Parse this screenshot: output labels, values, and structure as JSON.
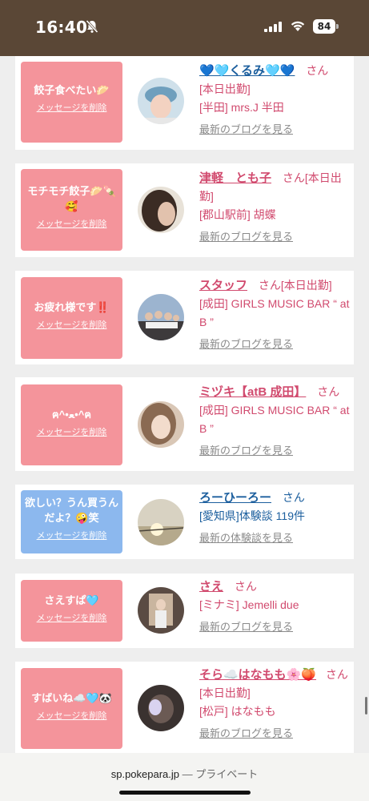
{
  "status_bar": {
    "time": "16:40",
    "battery": "84",
    "icons": [
      "bell-slash-icon",
      "signal-icon",
      "wifi-icon",
      "battery-icon"
    ]
  },
  "messages": [
    {
      "message": "餃子食べたい🥟",
      "delete_label": "メッセージを削除",
      "name": "💙🩵くるみ🩵💙",
      "honorific": "さん",
      "details": [
        "[本日出勤]",
        "[半田] mrs.J 半田"
      ],
      "link": "最新のブログを見る",
      "style": "pink"
    },
    {
      "message": "モチモチ餃子🥟🍡🥰",
      "delete_label": "メッセージを削除",
      "name": "津軽　とも子",
      "honorific": "さん[本日出勤]",
      "details": [
        "[郡山駅前] 胡蝶"
      ],
      "link": "最新のブログを見る",
      "style": "pink"
    },
    {
      "message": "お疲れ様です‼️",
      "delete_label": "メッセージを削除",
      "name": "スタッフ",
      "honorific": "さん[本日出勤]",
      "details": [
        "[成田] GIRLS MUSIC BAR “ at B ”"
      ],
      "link": "最新のブログを見る",
      "style": "pink"
    },
    {
      "message": "ฅ^•ﻌ•^ฅ",
      "delete_label": "メッセージを削除",
      "name": "ミヅキ【atB 成田】",
      "honorific": "さん",
      "details": [
        "[成田] GIRLS MUSIC BAR “ at B ”"
      ],
      "link": "最新のブログを見る",
      "style": "pink"
    },
    {
      "message": "欲しい？うん買うんだよ？🤪笑",
      "delete_label": "メッセージを削除",
      "name": "ろーひーろー",
      "honorific": "さん",
      "details": [
        "[愛知県]体験談 119件"
      ],
      "link": "最新の体験談を見る",
      "style": "blue"
    },
    {
      "message": "さえすぱ🩵",
      "delete_label": "メッセージを削除",
      "name": "さえ",
      "honorific": "さん",
      "details": [
        "[ミナミ] Jemelli due"
      ],
      "link": "最新のブログを見る",
      "style": "pink"
    },
    {
      "message": "すばいね☁️🩵🐼",
      "delete_label": "メッセージを削除",
      "name": "そら☁️はなもも🌸🍑",
      "honorific": "さん[本日出勤]",
      "details": [
        "[松戸] はなもも"
      ],
      "link": "最新のブログを見る",
      "style": "pink"
    }
  ],
  "url_bar": {
    "domain": "sp.pokepara.jp",
    "separator": " — ",
    "mode": "プライベート"
  },
  "colors": {
    "status_bar_bg": "#5a4736",
    "pink_bubble": "#f4949b",
    "blue_bubble": "#8cb8ee",
    "name_pink": "#d14a6e",
    "name_blue": "#1c5f9e"
  }
}
